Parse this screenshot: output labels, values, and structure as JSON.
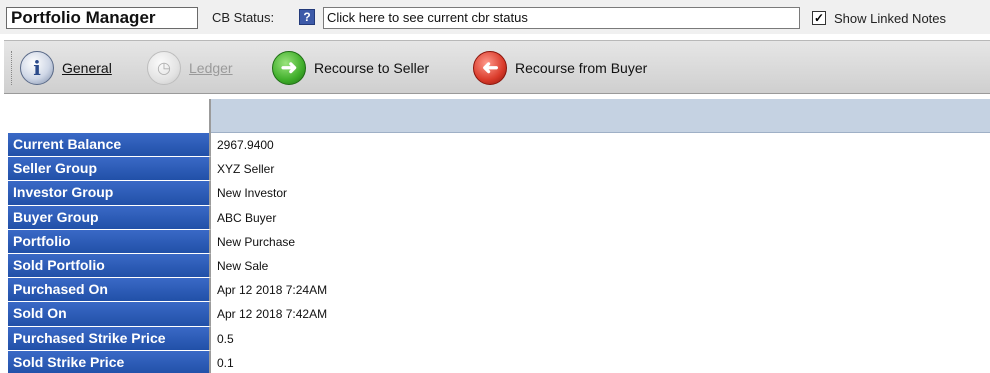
{
  "header": {
    "title": "Portfolio Manager",
    "cb_status_label": "CB Status:",
    "cb_status_icon": "help-icon",
    "cb_status_value": "Click here to see current cbr status",
    "show_linked_notes_label": "Show Linked Notes",
    "show_linked_notes_checked": true
  },
  "toolbar": {
    "buttons": [
      {
        "label": "General",
        "icon": "info-icon",
        "enabled": true
      },
      {
        "label": "Ledger",
        "icon": "ledger-icon",
        "enabled": false
      },
      {
        "label": "Recourse to Seller",
        "icon": "arrow-right-icon",
        "enabled": true
      },
      {
        "label": "Recourse from Buyer",
        "icon": "arrow-left-icon",
        "enabled": true
      }
    ]
  },
  "details": {
    "rows": [
      {
        "label": "Current Balance",
        "value": "2967.9400"
      },
      {
        "label": "Seller Group",
        "value": "XYZ Seller"
      },
      {
        "label": "Investor Group",
        "value": "New Investor"
      },
      {
        "label": "Buyer Group",
        "value": "ABC Buyer"
      },
      {
        "label": "Portfolio",
        "value": "New Purchase"
      },
      {
        "label": "Sold Portfolio",
        "value": "New Sale"
      },
      {
        "label": "Purchased On",
        "value": "Apr 12 2018  7:24AM"
      },
      {
        "label": "Sold On",
        "value": "Apr 12 2018  7:42AM"
      },
      {
        "label": "Purchased Strike Price",
        "value": "0.5"
      },
      {
        "label": "Sold Strike Price",
        "value": "0.1"
      }
    ]
  },
  "colors": {
    "label_background": "#2a5bb8",
    "header_band": "#c5d2e2",
    "toolbar_background": "#d9d9d9"
  }
}
